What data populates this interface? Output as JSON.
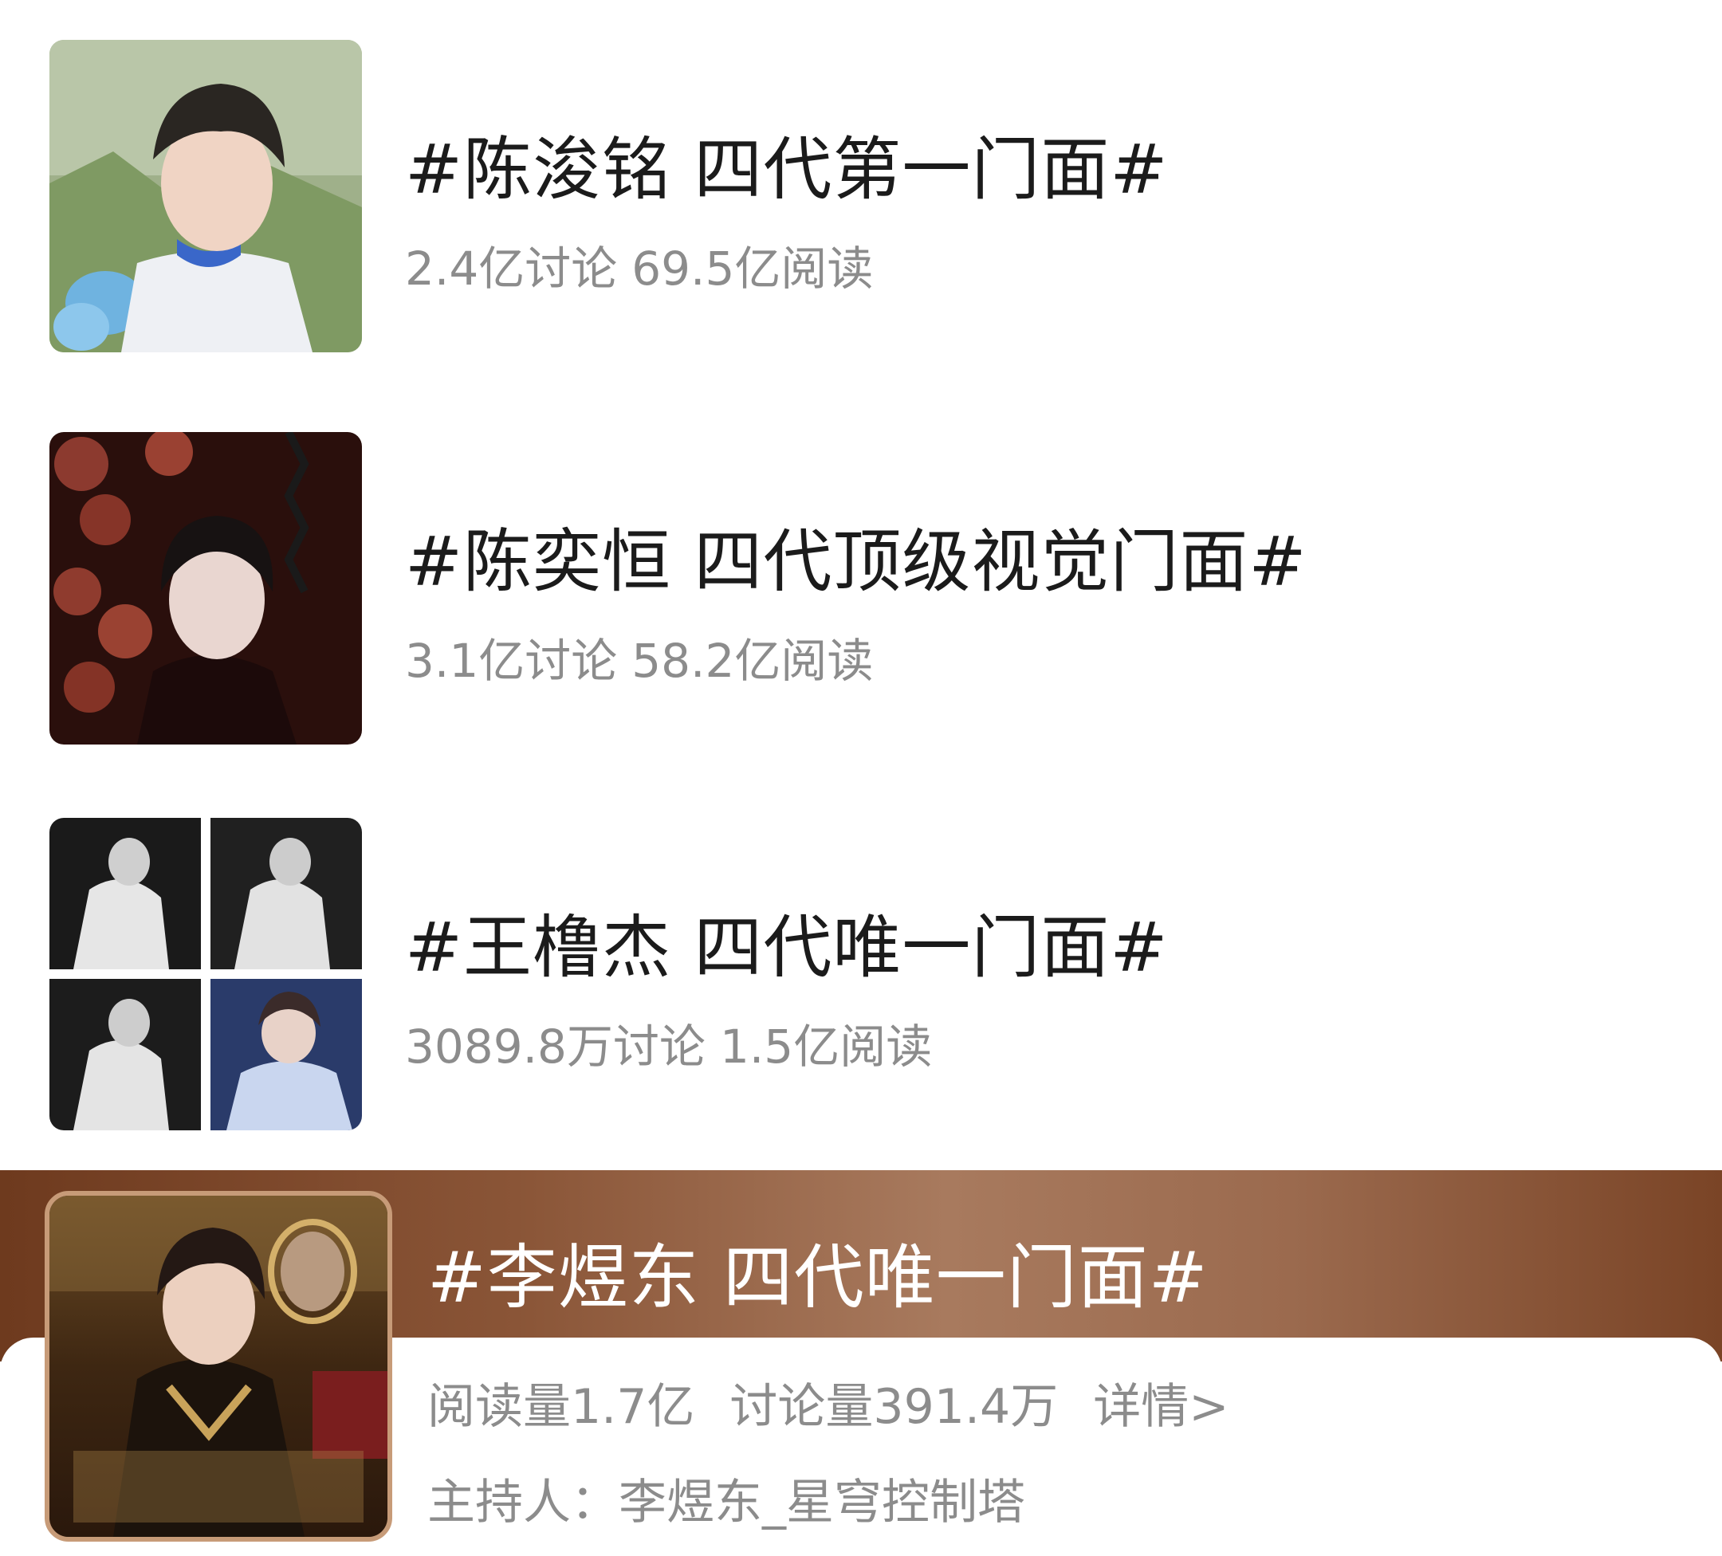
{
  "topics": [
    {
      "title": "#陈浚铭 四代第一门面#",
      "discussions": "2.4亿讨论",
      "reads": "69.5亿阅读",
      "thumbnail": "boy-in-white-sweater-photo"
    },
    {
      "title": "#陈奕恒 四代顶级视觉门面#",
      "discussions": "3.1亿讨论",
      "reads": "58.2亿阅读",
      "thumbnail": "roses-dark-red-photo"
    },
    {
      "title": "#王橹杰 四代唯一门面#",
      "discussions": "3089.8万讨论",
      "reads": "1.5亿阅读",
      "thumbnail": "four-panel-stage-collage"
    }
  ],
  "featured": {
    "title": "#李煜东 四代唯一门面#",
    "reads": "阅读量1.7亿",
    "discussions": "讨论量391.4万",
    "detail_link": "详情>",
    "host": "主持人：李煜东_星穹控制塔",
    "thumbnail": "gold-poster-photo",
    "banner_color": "#8a5537"
  }
}
